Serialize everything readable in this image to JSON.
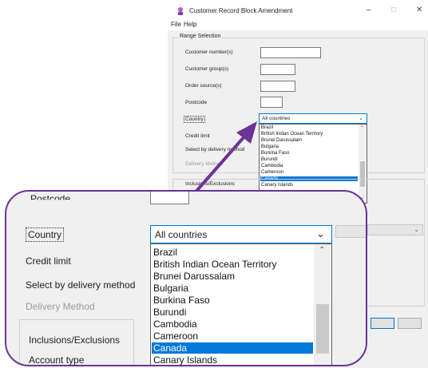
{
  "window": {
    "title": "Customer Record Block Amendment",
    "minimize_glyph": "–",
    "maximize_glyph": "□",
    "close_glyph": "✕",
    "icon": "app-icon"
  },
  "menu": [
    "File",
    "Help"
  ],
  "range_selection": {
    "label": "Range Selection",
    "fields": [
      {
        "label": "Customer number(s)",
        "value": ""
      },
      {
        "label": "Customer group(s)",
        "value": ""
      },
      {
        "label": "Order source(s)",
        "value": ""
      },
      {
        "label": "Postcode",
        "value": ""
      }
    ],
    "country_label": "Country",
    "credit_limit_label": "Credit limit",
    "select_delivery_label": "Select by delivery method",
    "delivery_method_label": "Delivery Method"
  },
  "country_combo": {
    "selected": "All countries",
    "options": [
      "Brazil",
      "British Indian Ocean Territory",
      "Brunei Darussalam",
      "Bulgaria",
      "Burkina Faso",
      "Burundi",
      "Cambodia",
      "Cameroon",
      "Canada",
      "Canary Islands"
    ],
    "highlighted": "Canada"
  },
  "inclusions": {
    "label": "Inclusions/Exclusions",
    "account_type_label": "Account type"
  },
  "magnified": {
    "postcode_label": "Postcode"
  },
  "colors": {
    "accent": "#0078d7",
    "callout": "#6c3399"
  }
}
